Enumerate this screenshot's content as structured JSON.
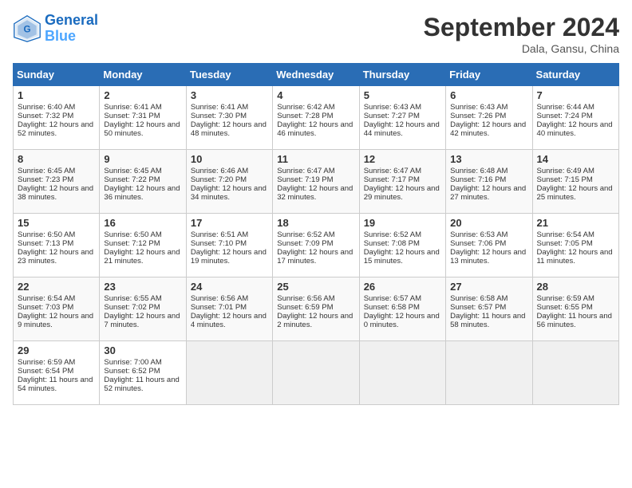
{
  "header": {
    "logo_line1": "General",
    "logo_line2": "Blue",
    "month": "September 2024",
    "location": "Dala, Gansu, China"
  },
  "days_of_week": [
    "Sunday",
    "Monday",
    "Tuesday",
    "Wednesday",
    "Thursday",
    "Friday",
    "Saturday"
  ],
  "weeks": [
    [
      {
        "day": 1,
        "sunrise": "6:40 AM",
        "sunset": "7:32 PM",
        "daylight": "12 hours and 52 minutes."
      },
      {
        "day": 2,
        "sunrise": "6:41 AM",
        "sunset": "7:31 PM",
        "daylight": "12 hours and 50 minutes."
      },
      {
        "day": 3,
        "sunrise": "6:41 AM",
        "sunset": "7:30 PM",
        "daylight": "12 hours and 48 minutes."
      },
      {
        "day": 4,
        "sunrise": "6:42 AM",
        "sunset": "7:28 PM",
        "daylight": "12 hours and 46 minutes."
      },
      {
        "day": 5,
        "sunrise": "6:43 AM",
        "sunset": "7:27 PM",
        "daylight": "12 hours and 44 minutes."
      },
      {
        "day": 6,
        "sunrise": "6:43 AM",
        "sunset": "7:26 PM",
        "daylight": "12 hours and 42 minutes."
      },
      {
        "day": 7,
        "sunrise": "6:44 AM",
        "sunset": "7:24 PM",
        "daylight": "12 hours and 40 minutes."
      }
    ],
    [
      {
        "day": 8,
        "sunrise": "6:45 AM",
        "sunset": "7:23 PM",
        "daylight": "12 hours and 38 minutes."
      },
      {
        "day": 9,
        "sunrise": "6:45 AM",
        "sunset": "7:22 PM",
        "daylight": "12 hours and 36 minutes."
      },
      {
        "day": 10,
        "sunrise": "6:46 AM",
        "sunset": "7:20 PM",
        "daylight": "12 hours and 34 minutes."
      },
      {
        "day": 11,
        "sunrise": "6:47 AM",
        "sunset": "7:19 PM",
        "daylight": "12 hours and 32 minutes."
      },
      {
        "day": 12,
        "sunrise": "6:47 AM",
        "sunset": "7:17 PM",
        "daylight": "12 hours and 29 minutes."
      },
      {
        "day": 13,
        "sunrise": "6:48 AM",
        "sunset": "7:16 PM",
        "daylight": "12 hours and 27 minutes."
      },
      {
        "day": 14,
        "sunrise": "6:49 AM",
        "sunset": "7:15 PM",
        "daylight": "12 hours and 25 minutes."
      }
    ],
    [
      {
        "day": 15,
        "sunrise": "6:50 AM",
        "sunset": "7:13 PM",
        "daylight": "12 hours and 23 minutes."
      },
      {
        "day": 16,
        "sunrise": "6:50 AM",
        "sunset": "7:12 PM",
        "daylight": "12 hours and 21 minutes."
      },
      {
        "day": 17,
        "sunrise": "6:51 AM",
        "sunset": "7:10 PM",
        "daylight": "12 hours and 19 minutes."
      },
      {
        "day": 18,
        "sunrise": "6:52 AM",
        "sunset": "7:09 PM",
        "daylight": "12 hours and 17 minutes."
      },
      {
        "day": 19,
        "sunrise": "6:52 AM",
        "sunset": "7:08 PM",
        "daylight": "12 hours and 15 minutes."
      },
      {
        "day": 20,
        "sunrise": "6:53 AM",
        "sunset": "7:06 PM",
        "daylight": "12 hours and 13 minutes."
      },
      {
        "day": 21,
        "sunrise": "6:54 AM",
        "sunset": "7:05 PM",
        "daylight": "12 hours and 11 minutes."
      }
    ],
    [
      {
        "day": 22,
        "sunrise": "6:54 AM",
        "sunset": "7:03 PM",
        "daylight": "12 hours and 9 minutes."
      },
      {
        "day": 23,
        "sunrise": "6:55 AM",
        "sunset": "7:02 PM",
        "daylight": "12 hours and 7 minutes."
      },
      {
        "day": 24,
        "sunrise": "6:56 AM",
        "sunset": "7:01 PM",
        "daylight": "12 hours and 4 minutes."
      },
      {
        "day": 25,
        "sunrise": "6:56 AM",
        "sunset": "6:59 PM",
        "daylight": "12 hours and 2 minutes."
      },
      {
        "day": 26,
        "sunrise": "6:57 AM",
        "sunset": "6:58 PM",
        "daylight": "12 hours and 0 minutes."
      },
      {
        "day": 27,
        "sunrise": "6:58 AM",
        "sunset": "6:57 PM",
        "daylight": "11 hours and 58 minutes."
      },
      {
        "day": 28,
        "sunrise": "6:59 AM",
        "sunset": "6:55 PM",
        "daylight": "11 hours and 56 minutes."
      }
    ],
    [
      {
        "day": 29,
        "sunrise": "6:59 AM",
        "sunset": "6:54 PM",
        "daylight": "11 hours and 54 minutes."
      },
      {
        "day": 30,
        "sunrise": "7:00 AM",
        "sunset": "6:52 PM",
        "daylight": "11 hours and 52 minutes."
      },
      null,
      null,
      null,
      null,
      null
    ]
  ]
}
